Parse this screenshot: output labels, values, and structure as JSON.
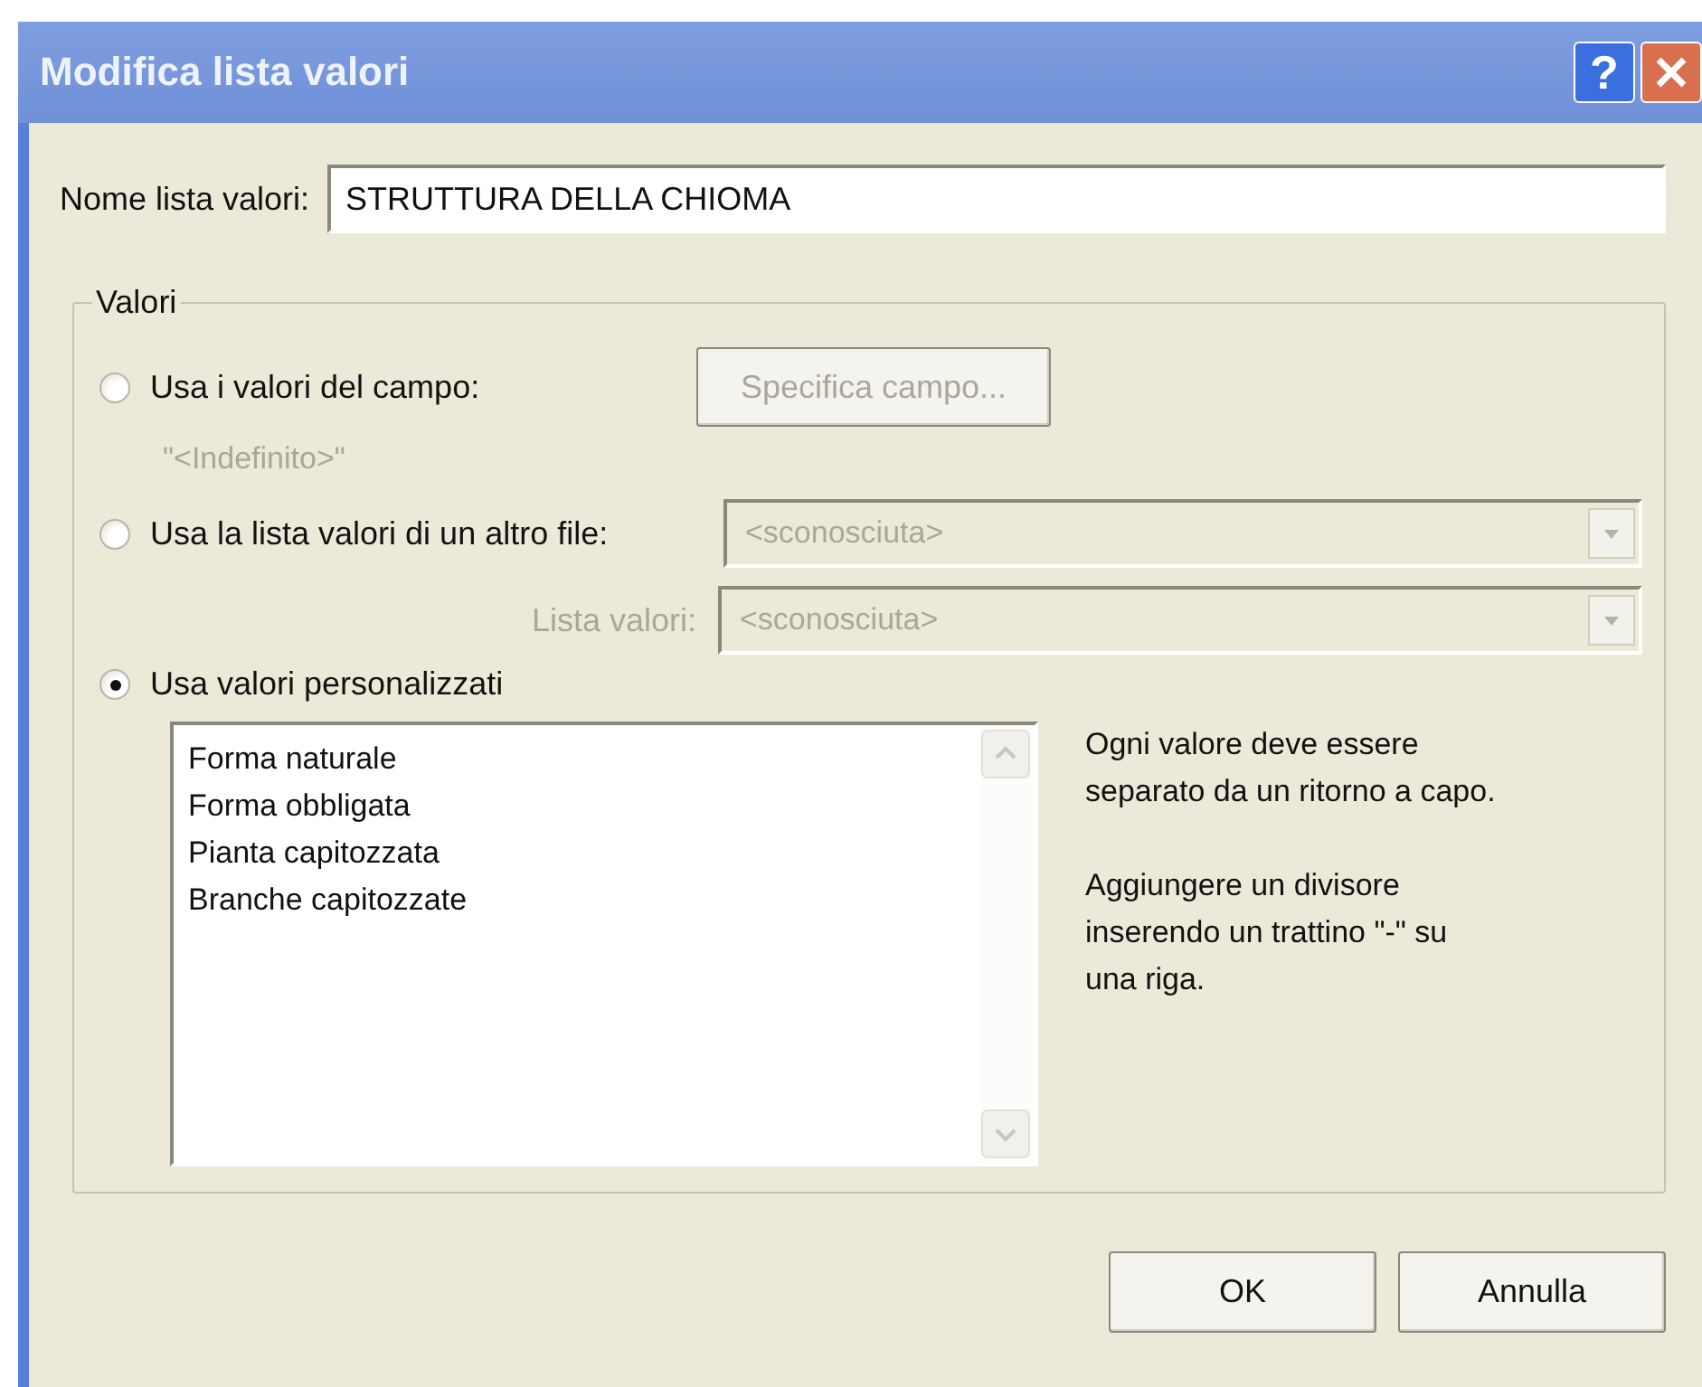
{
  "window": {
    "title": "Modifica lista valori",
    "help": "?"
  },
  "name_field": {
    "label": "Nome lista valori:",
    "value": "STRUTTURA DELLA CHIOMA"
  },
  "group": {
    "title": "Valori",
    "options": [
      {
        "kind": "field",
        "label": "Usa i valori del campo:",
        "selected": false,
        "button": {
          "label": "Specifica campo...",
          "disabled": true
        },
        "note": "\"<Indefinito>\""
      },
      {
        "kind": "file",
        "label": "Usa la lista valori di un altro file:",
        "selected": false,
        "combos": [
          {
            "value": "<sconosciuta>",
            "disabled": true
          },
          {
            "label": "Lista valori:",
            "value": "<sconosciuta>",
            "disabled": true
          }
        ]
      },
      {
        "kind": "custom",
        "label": "Usa valori personalizzati",
        "selected": true,
        "lines": [
          "Forma naturale",
          "Forma obbligata",
          "Pianta capitozzata",
          "Branche capitozzate"
        ],
        "hints": [
          "Ogni valore deve essere separato da un ritorno a capo.",
          "Aggiungere un divisore inserendo un trattino \"-\" su una riga."
        ]
      }
    ]
  },
  "buttons": [
    "OK",
    "Annulla"
  ]
}
